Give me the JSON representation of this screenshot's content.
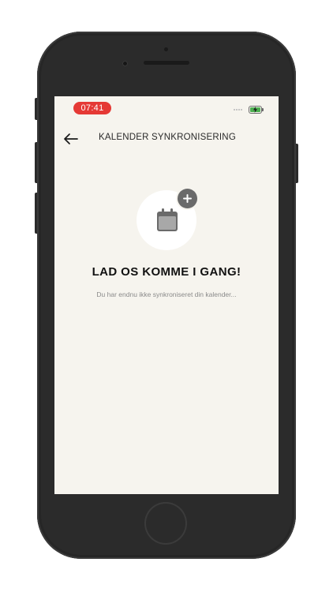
{
  "status_bar": {
    "time": "07:41"
  },
  "header": {
    "title": "KALENDER SYNKRONISERING"
  },
  "empty_state": {
    "headline": "LAD OS KOMME I GANG!",
    "message": "Du har endnu ikke synkroniseret din kalender..."
  },
  "icons": {
    "back": "arrow-left-icon",
    "illustration": "calendar-icon",
    "add": "plus-icon",
    "battery": "battery-charging-icon"
  },
  "colors": {
    "screen_background": "#f6f4ee",
    "time_pill": "#e53935",
    "battery_charge": "#4caf50",
    "calendar_icon": "#6a6a6a",
    "phone_frame": "#2b2b2b"
  }
}
